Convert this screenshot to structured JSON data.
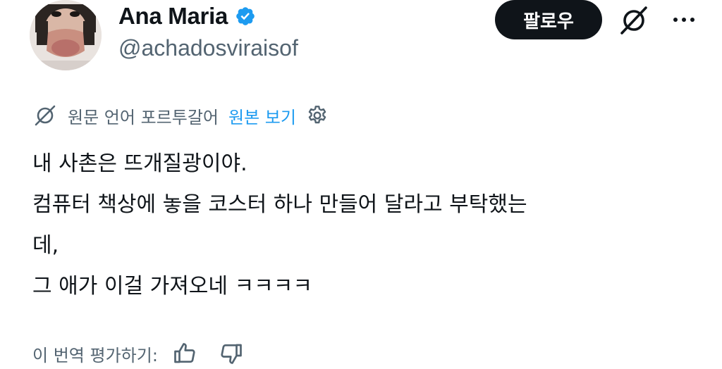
{
  "author": {
    "display_name": "Ana Maria",
    "handle": "@achadosviraisof",
    "verified": true,
    "verified_color": "#1d9bf0"
  },
  "actions": {
    "follow_label": "팔로우",
    "grok_icon": "grok-icon",
    "more_icon": "more-dots-icon"
  },
  "translation": {
    "note": "원문 언어 포르투갈어",
    "view_original": "원본 보기",
    "icon": "grok-translate-icon",
    "settings_icon": "gear-icon"
  },
  "tweet": {
    "lines": [
      "내 사촌은 뜨개질광이야.",
      "컴퓨터 책상에 놓을 코스터 하나 만들어 달라고 부탁했는",
      "데,",
      "그 애가 이걸 가져오네 ㅋㅋㅋㅋ"
    ]
  },
  "rating": {
    "label": "이 번역 평가하기:",
    "thumbs_up_icon": "thumbs-up-icon",
    "thumbs_down_icon": "thumbs-down-icon"
  },
  "colors": {
    "text_primary": "#0f1419",
    "text_secondary": "#536471",
    "link": "#1d9bf0",
    "button_bg": "#0f1419"
  }
}
